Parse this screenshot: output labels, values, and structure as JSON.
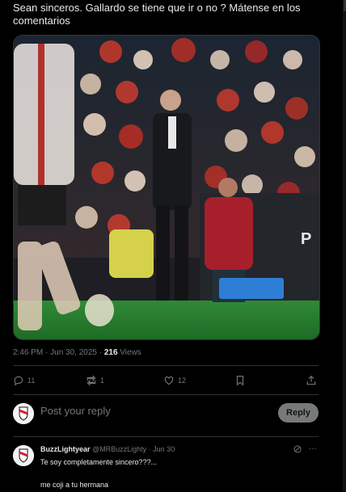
{
  "post": {
    "text": "Sean sinceros. Gallardo se tiene que ir o no ? Mátense en los comentarios"
  },
  "meta": {
    "time_date": "2:46 PM · Jun 30, 2025 · ",
    "views_count": "216",
    "views_label": " Views"
  },
  "actions": {
    "replies": "11",
    "reposts": "1",
    "likes": "12"
  },
  "reply_box": {
    "placeholder": "Post your reply",
    "button_label": "Reply"
  },
  "comment": {
    "display_name": "BuzzLightyear",
    "handle_date": " @MRBuzzLighty · Jun 30",
    "line1": "Te soy completamente sincero???...",
    "line2": "me coji a tu hermana"
  },
  "colors": {
    "background": "#000000",
    "text": "#e7e9ea",
    "muted": "#71767b",
    "divider": "#2f3336",
    "reply_button": "#787a7a"
  }
}
